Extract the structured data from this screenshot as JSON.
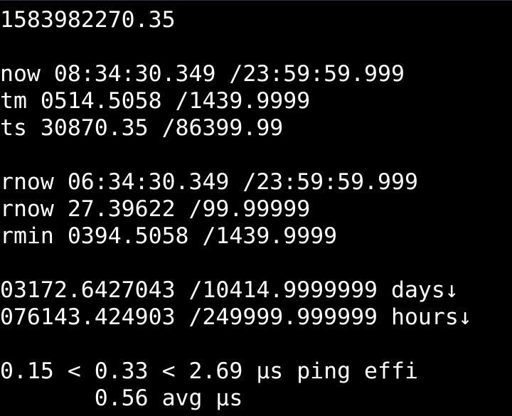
{
  "terminal": {
    "lines": [
      "1583982270.35",
      "now 08:34:30.349 /23:59:59.999",
      "tm 0514.5058 /1439.9999",
      "ts 30870.35 /86399.99",
      "rnow 06:34:30.349 /23:59:59.999",
      "rnow 27.39622 /99.99999",
      "rmin 0394.5058 /1439.9999",
      "03172.6427043 /10414.9999999 days↓",
      "076143.424903 /249999.999999 hours↓",
      "0.15 < 0.33 < 2.69 µs ping effi",
      "       0.56 avg µs"
    ]
  },
  "colors": {
    "background": "#000000",
    "foreground": "#ffffff"
  }
}
